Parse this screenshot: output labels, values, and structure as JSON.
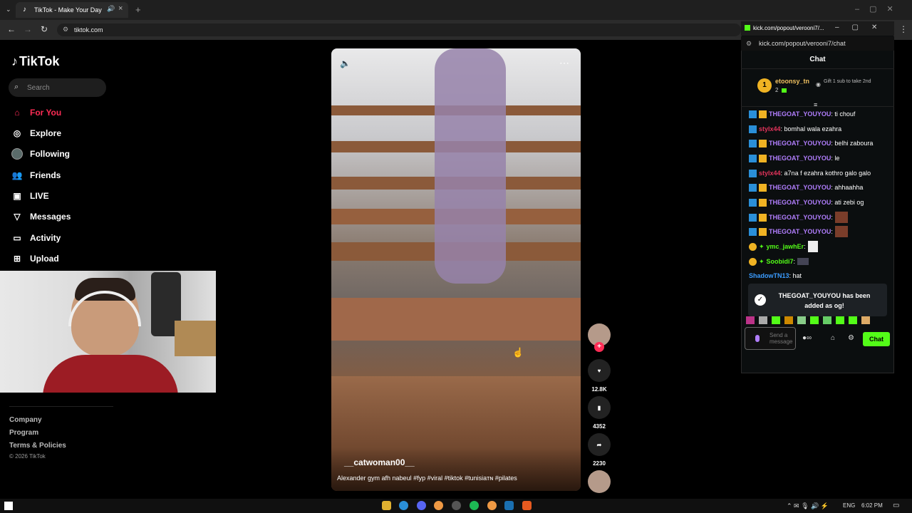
{
  "browser": {
    "tab_title": "TikTok - Make Your Day",
    "url": "tiktok.com"
  },
  "tiktok": {
    "logo": "TikTok",
    "search_placeholder": "Search",
    "nav": [
      {
        "label": "For You",
        "icon": "home-icon",
        "active": true
      },
      {
        "label": "Explore",
        "icon": "compass-icon"
      },
      {
        "label": "Following",
        "icon": "following-icon"
      },
      {
        "label": "Friends",
        "icon": "friends-icon"
      },
      {
        "label": "LIVE",
        "icon": "live-icon"
      },
      {
        "label": "Messages",
        "icon": "messages-icon"
      },
      {
        "label": "Activity",
        "icon": "activity-icon"
      },
      {
        "label": "Upload",
        "icon": "upload-icon"
      }
    ],
    "footer": {
      "company": "Company",
      "program": "Program",
      "terms": "Terms & Policies",
      "copyright": "© 2026 TikTok"
    },
    "video": {
      "username": "__catwoman00__",
      "caption": "Alexander gym afh nabeul #fyp #viral #tiktok #tunisiaᴛɴ #pilates"
    },
    "actions": {
      "likes": "12.8K",
      "saves": "4352",
      "shares": "2230"
    }
  },
  "kick": {
    "url_title": "kick.com/popout/verooni7/...",
    "url": "kick.com/popout/verooni7/chat",
    "header": "Chat",
    "pinned": {
      "rank": "1",
      "name": "etoonsy_tn",
      "count": "2",
      "gift_text": "Gift 1 sub to take 2nd"
    },
    "messages": [
      {
        "user": "THEGOAT_YOUYOU",
        "text": "ti chouf",
        "color": "#b07dfc"
      },
      {
        "user": "stylx44",
        "text": "bomhal wala ezahra",
        "color": "#e0335a"
      },
      {
        "user": "THEGOAT_YOUYOU",
        "text": "belhi zaboura",
        "color": "#b07dfc"
      },
      {
        "user": "THEGOAT_YOUYOU",
        "text": "le",
        "color": "#b07dfc"
      },
      {
        "user": "stylx44",
        "text": "a7na f ezahra kothro galo galo",
        "color": "#e0335a"
      },
      {
        "user": "THEGOAT_YOUYOU",
        "text": "ahhaahha",
        "color": "#b07dfc"
      },
      {
        "user": "THEGOAT_YOUYOU",
        "text": "ati zebi og",
        "color": "#b07dfc"
      },
      {
        "user": "THEGOAT_YOUYOU",
        "text": "",
        "color": "#b07dfc"
      },
      {
        "user": "THEGOAT_YOUYOU",
        "text": "",
        "color": "#b07dfc"
      },
      {
        "user": "ymc_jawhEr",
        "text": "",
        "color": "#53fc18"
      },
      {
        "user": "Soobidi7",
        "text": "",
        "color": "#53fc18"
      },
      {
        "user": "ShadowTN13",
        "text": "hat",
        "color": "#3b9cff"
      }
    ],
    "toast": "THEGOAT_YOUYOU has been added as og!",
    "input_placeholder": "Send a message",
    "chat_button": "Chat"
  },
  "taskbar": {
    "lang": "ENG",
    "time": "6:02 PM"
  }
}
